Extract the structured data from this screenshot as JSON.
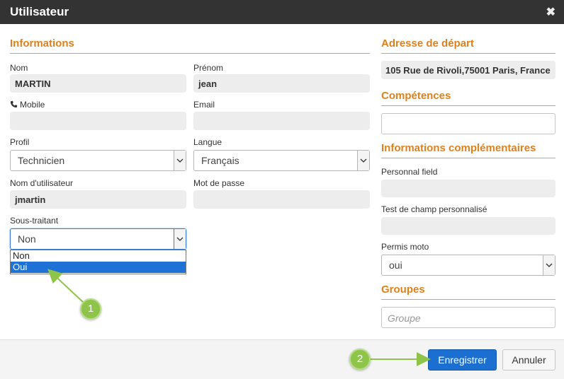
{
  "dialog": {
    "title": "Utilisateur",
    "close_glyph": "✖"
  },
  "left": {
    "section_title": "Informations",
    "nom_label": "Nom",
    "nom_value": "MARTIN",
    "prenom_label": "Prénom",
    "prenom_value": "jean",
    "mobile_label": "Mobile",
    "mobile_value": "",
    "email_label": "Email",
    "email_value": "",
    "profil_label": "Profil",
    "profil_value": "Technicien",
    "langue_label": "Langue",
    "langue_value": "Français",
    "username_label": "Nom d'utilisateur",
    "username_value": "jmartin",
    "password_label": "Mot de passe",
    "password_value": "",
    "sous_traitant_label": "Sous-traitant",
    "sous_traitant_value": "Non",
    "sous_traitant_options": [
      "Non",
      "Oui"
    ],
    "sous_traitant_highlighted": "Oui"
  },
  "right": {
    "adresse_title": "Adresse de départ",
    "adresse_value": "105 Rue de Rivoli,75001 Paris, France",
    "competences_title": "Compétences",
    "competences_value": "",
    "infos_title": "Informations complémentaires",
    "personnal_label": "Personnal field",
    "personnal_value": "",
    "test_label": "Test de champ personnalisé",
    "test_value": "",
    "permis_label": "Permis moto",
    "permis_value": "oui",
    "groupes_title": "Groupes",
    "groupe_placeholder": "Groupe"
  },
  "footer": {
    "save_label": "Enregistrer",
    "cancel_label": "Annuler"
  },
  "callouts": {
    "one": "1",
    "two": "2"
  },
  "colors": {
    "section_heading": "#e0801a",
    "titlebar": "#333333",
    "primary_button": "#1a6fd0",
    "callout": "#8dc449"
  }
}
